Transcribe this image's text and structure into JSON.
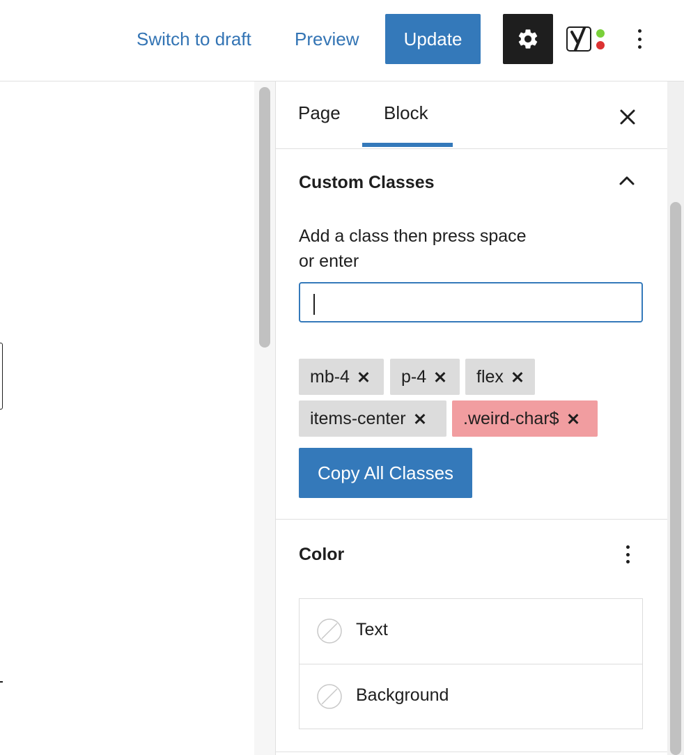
{
  "topbar": {
    "switch_to_draft": "Switch to draft",
    "preview": "Preview",
    "update": "Update",
    "settings_icon": "gear-icon",
    "yoast_icon": "yoast-icon",
    "options_icon": "more-vertical-icon"
  },
  "sidebar": {
    "tabs": [
      {
        "label": "Page",
        "active": false
      },
      {
        "label": "Block",
        "active": true
      }
    ],
    "close_icon": "close-icon"
  },
  "custom_classes": {
    "title": "Custom Classes",
    "expanded": true,
    "help_line1": "Add a class then press space",
    "help_line2": "or enter",
    "input_value": "",
    "chips": [
      {
        "label": "mb-4",
        "valid": true
      },
      {
        "label": "p-4",
        "valid": true
      },
      {
        "label": "flex",
        "valid": true
      },
      {
        "label": "items-center",
        "valid": true
      },
      {
        "label": ".weird-char$",
        "valid": false
      }
    ],
    "copy_button": "Copy All Classes"
  },
  "color": {
    "title": "Color",
    "options_icon": "more-vertical-icon",
    "items": [
      {
        "label": "Text"
      },
      {
        "label": "Background"
      }
    ]
  },
  "colors": {
    "accent": "#3479ba",
    "chip": "#dcdcdc",
    "chip_invalid": "#f19da0",
    "yoast_green": "#7ad03a",
    "yoast_red": "#dc3232"
  }
}
